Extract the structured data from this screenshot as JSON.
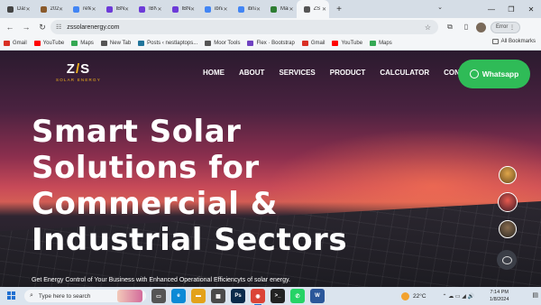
{
  "browser": {
    "tabs": [
      {
        "title": "Dashb",
        "icon": "dashboard-icon",
        "color": "#444444"
      },
      {
        "title": "2023 :",
        "icon": "document-icon",
        "color": "#8a5a2b"
      },
      {
        "title": "refere",
        "icon": "google-icon",
        "color": "#4285f4"
      },
      {
        "title": "IBN-I",
        "icon": "bookmark-icon",
        "color": "#6d3bd8"
      },
      {
        "title": "IBN-I",
        "icon": "bookmark-icon",
        "color": "#6d3bd8"
      },
      {
        "title": "IBN-I",
        "icon": "bookmark-icon",
        "color": "#6d3bd8"
      },
      {
        "title": "ibna",
        "icon": "google-icon",
        "color": "#4285f4"
      },
      {
        "title": "ibna",
        "icon": "google-icon",
        "color": "#4285f4"
      },
      {
        "title": "Man",
        "icon": "image-icon",
        "color": "#2e7d32"
      },
      {
        "title": "ZS Sc",
        "icon": "site-icon",
        "color": "#555555"
      }
    ],
    "url": "zssolarenergy.com",
    "error_label": "Error",
    "bookmarks": [
      {
        "label": "Gmail",
        "icon": "gmail-icon",
        "color": "#d93025"
      },
      {
        "label": "YouTube",
        "icon": "youtube-icon",
        "color": "#ff0000"
      },
      {
        "label": "Maps",
        "icon": "maps-icon",
        "color": "#34a853"
      },
      {
        "label": "New Tab",
        "icon": "settings-icon",
        "color": "#555555"
      },
      {
        "label": "Posts ‹ nestlaptops...",
        "icon": "wordpress-icon",
        "color": "#21759b"
      },
      {
        "label": "Moor Tools",
        "icon": "settings-icon",
        "color": "#555555"
      },
      {
        "label": "Flex · Bootstrap",
        "icon": "page-icon",
        "color": "#6f42c1"
      },
      {
        "label": "Gmail",
        "icon": "gmail-icon",
        "color": "#d93025"
      },
      {
        "label": "YouTube",
        "icon": "youtube-icon",
        "color": "#ff0000"
      },
      {
        "label": "Maps",
        "icon": "maps-icon",
        "color": "#34a853"
      }
    ],
    "all_bookmarks": "All Bookmarks"
  },
  "site": {
    "logo_text": "Z/S",
    "logo_tagline": "SOLAR ENERGY",
    "nav": [
      "HOME",
      "ABOUT",
      "SERVICES",
      "PRODUCT",
      "CALCULATOR",
      "CONTACT"
    ],
    "whatsapp_label": "Whatsapp",
    "hero_title": "Smart Solar Solutions for Commercial & Industrial Sectors",
    "hero_subtitle": "Get Energy Control of Your Business with Enhanced Operational Efficiencyts of solar energy."
  },
  "taskbar": {
    "search_placeholder": "Type here to search",
    "temperature": "22°C",
    "time": "7:14 PM",
    "date": "1/8/2024",
    "apps": [
      {
        "name": "task-view-icon",
        "color": "#555555",
        "glyph": "▭"
      },
      {
        "name": "edge-icon",
        "color": "#0c8ad6",
        "glyph": "e"
      },
      {
        "name": "file-explorer-icon",
        "color": "#e3a21a",
        "glyph": "▬"
      },
      {
        "name": "store-icon",
        "color": "#4a4a4a",
        "glyph": "▦"
      },
      {
        "name": "photoshop-icon",
        "color": "#0a2a4a",
        "glyph": "Ps"
      },
      {
        "name": "chrome-icon",
        "color": "#db4437",
        "glyph": "◉"
      },
      {
        "name": "terminal-icon",
        "color": "#222222",
        "glyph": ">_"
      },
      {
        "name": "whatsapp-icon",
        "color": "#25d366",
        "glyph": "✆"
      },
      {
        "name": "word-icon",
        "color": "#2b579a",
        "glyph": "W"
      }
    ]
  }
}
